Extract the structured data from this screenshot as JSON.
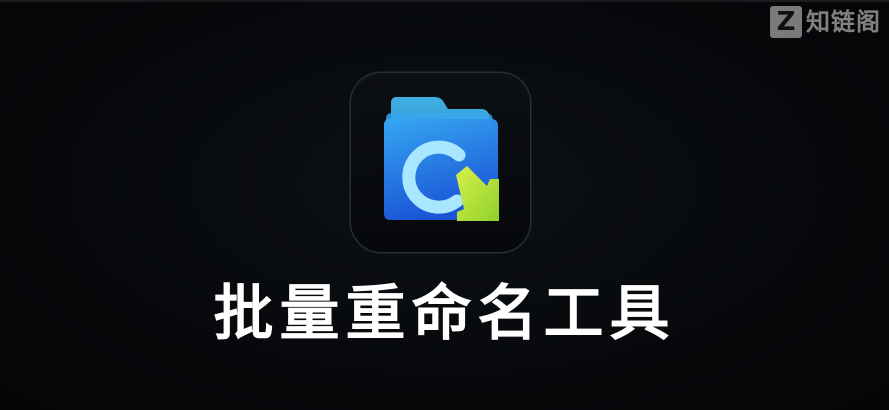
{
  "watermark": {
    "badge_letter": "Z",
    "text": "知链阁"
  },
  "app": {
    "icon_name": "batch-rename-folder-icon",
    "title": "批量重命名工具"
  },
  "colors": {
    "background": "#050608",
    "folder_back": "#2f9df0",
    "folder_front": "#1f6fe0",
    "ring": "#a8e4ff",
    "arrow": "#b7e33a",
    "title_text": "#ffffff"
  }
}
